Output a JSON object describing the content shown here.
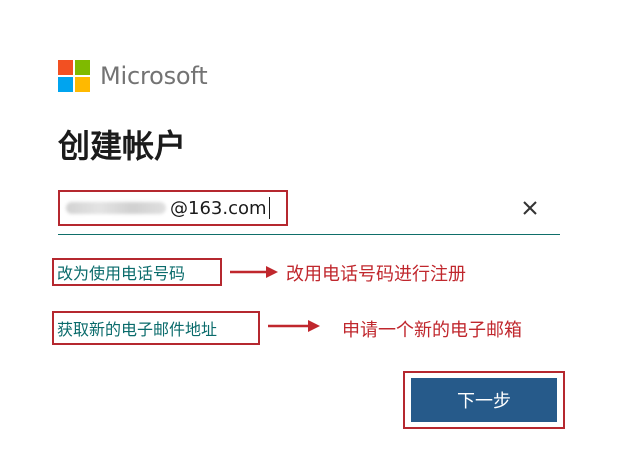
{
  "brand": {
    "name": "Microsoft",
    "colors": [
      "#f25022",
      "#7fba00",
      "#00a4ef",
      "#ffb900"
    ]
  },
  "page": {
    "title": "创建帐户"
  },
  "email_field": {
    "value": "@163.com",
    "clear_icon": "close-icon"
  },
  "links": {
    "use_phone": "改为使用电话号码",
    "get_new_email": "获取新的电子邮件地址"
  },
  "annotations": {
    "use_phone_note": "改用电话号码进行注册",
    "new_email_note": "申请一个新的电子邮箱",
    "color": "#c0272d"
  },
  "actions": {
    "next_label": "下一步"
  }
}
